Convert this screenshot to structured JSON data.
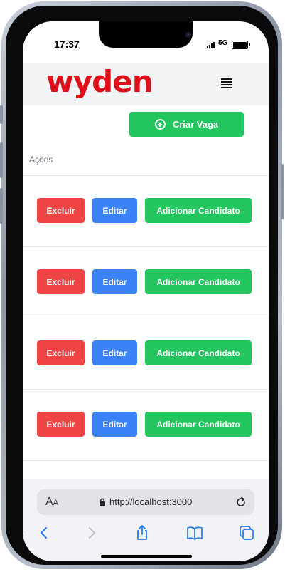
{
  "status_bar": {
    "time": "17:37",
    "network": "5G"
  },
  "header": {
    "logo_text": "wyden",
    "menu_icon": "hamburger-icon"
  },
  "actions": {
    "create_label": "Criar Vaga",
    "create_icon": "plus-circle-icon",
    "column_header": "Ações",
    "rows": [
      {
        "delete_label": "Excluir",
        "edit_label": "Editar",
        "add_label": "Adicionar Candidato"
      },
      {
        "delete_label": "Excluir",
        "edit_label": "Editar",
        "add_label": "Adicionar Candidato"
      },
      {
        "delete_label": "Excluir",
        "edit_label": "Editar",
        "add_label": "Adicionar Candidato"
      },
      {
        "delete_label": "Excluir",
        "edit_label": "Editar",
        "add_label": "Adicionar Candidato"
      }
    ]
  },
  "browser": {
    "text_size_label": "A",
    "text_size_small": "A",
    "url": "http://localhost:3000",
    "icons": [
      "back-icon",
      "forward-icon",
      "share-icon",
      "bookmarks-icon",
      "tabs-icon",
      "lock-icon",
      "reload-icon"
    ]
  },
  "colors": {
    "brand": "#e0101a",
    "success": "#22c55e",
    "danger": "#ef4444",
    "primary": "#3b82f6",
    "ios_blue": "#1e7bf2"
  }
}
